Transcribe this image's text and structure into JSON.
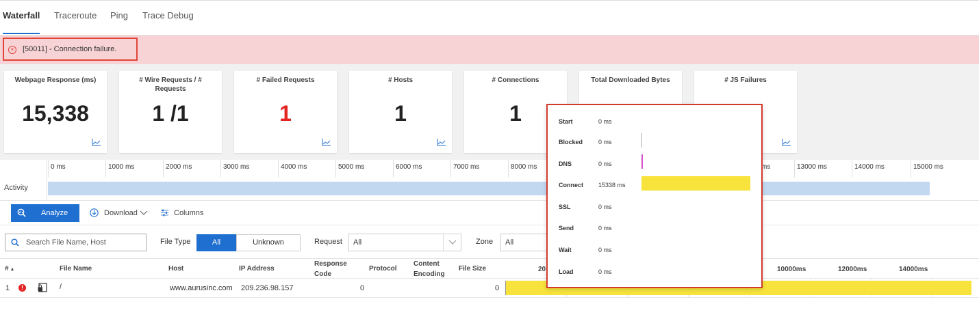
{
  "tabs": [
    {
      "label": "Waterfall",
      "active": true
    },
    {
      "label": "Traceroute"
    },
    {
      "label": "Ping"
    },
    {
      "label": "Trace Debug"
    }
  ],
  "alert": {
    "message": "[50011] - Connection failure.",
    "icon": "error-circle-icon",
    "color": "#e0453a"
  },
  "metrics": [
    {
      "title": "Webpage Response (ms)",
      "value": "15,338"
    },
    {
      "title": "# Wire Requests / # Requests",
      "value": "1 /1"
    },
    {
      "title": "# Failed Requests",
      "value": "1",
      "color": "#e32222"
    },
    {
      "title": "# Hosts",
      "value": "1"
    },
    {
      "title": "# Connections",
      "value": "1"
    },
    {
      "title": "Total Downloaded Bytes",
      "value": ""
    },
    {
      "title": "# JS Failures",
      "value": ""
    }
  ],
  "timeline": {
    "label": "Activity",
    "ticks": [
      "0 ms",
      "1000 ms",
      "2000 ms",
      "3000 ms",
      "4000 ms",
      "5000 ms",
      "6000 ms",
      "7000 ms",
      "8000 ms",
      "13000 ms",
      "14000 ms",
      "15000 ms"
    ],
    "tick_partial": "ms",
    "activity_start_ms": 0,
    "activity_end_ms": 15338
  },
  "toolbar": {
    "analyze": "Analyze",
    "download": "Download",
    "columns": "Columns"
  },
  "filters": {
    "search_placeholder": "Search File Name, Host",
    "file_type_label": "File Type",
    "file_type_options": [
      "All",
      "Unknown"
    ],
    "file_type_selected": "All",
    "request_label": "Request",
    "request_value": "All",
    "zone_label": "Zone",
    "zone_value": "All"
  },
  "table": {
    "columns": {
      "num": "#",
      "file_name": "File Name",
      "host": "Host",
      "ip": "IP Address",
      "response_code": "Response Code",
      "protocol": "Protocol",
      "content_encoding": "Content Encoding",
      "file_size": "File Size"
    },
    "waterfall_ticks": [
      "20",
      "10000ms",
      "12000ms",
      "14000ms"
    ],
    "rows": [
      {
        "num": "1",
        "file_name": "/",
        "host": "www.aurusinc.com",
        "ip": "209.236.98.157",
        "response_code": "0",
        "protocol": "",
        "content_encoding": "",
        "file_size": "0"
      }
    ]
  },
  "popup": {
    "rows": [
      {
        "label": "Start",
        "value": "0 ms"
      },
      {
        "label": "Blocked",
        "value": "0 ms",
        "bar_color": "#aaaaaa"
      },
      {
        "label": "DNS",
        "value": "0 ms",
        "bar_color": "#d94fd0"
      },
      {
        "label": "Connect",
        "value": "15338 ms",
        "bar_color": "#f7e33b"
      },
      {
        "label": "SSL",
        "value": "0 ms"
      },
      {
        "label": "Send",
        "value": "0 ms"
      },
      {
        "label": "Wait",
        "value": "0 ms"
      },
      {
        "label": "Load",
        "value": "0 ms"
      }
    ]
  },
  "colors": {
    "accent": "#1f6fd1",
    "error": "#e32222",
    "activity": "#c2d8f0",
    "connect_bar": "#f7e33b"
  }
}
